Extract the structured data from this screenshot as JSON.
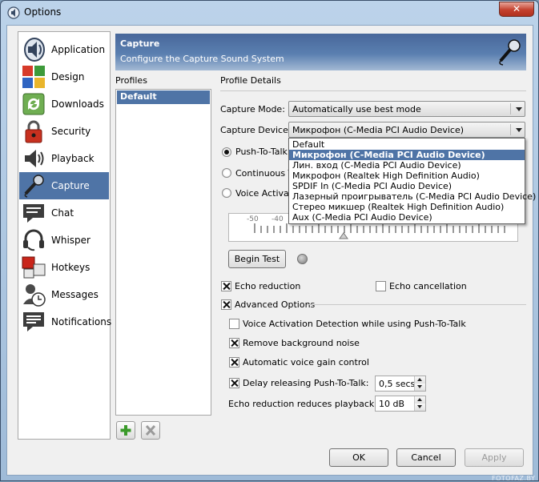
{
  "window": {
    "title": "Options",
    "close_glyph": "✕"
  },
  "nav": {
    "items": [
      {
        "label": "Application",
        "icon": "speaker-logo-icon",
        "selected": false
      },
      {
        "label": "Design",
        "icon": "color-squares-icon",
        "selected": false
      },
      {
        "label": "Downloads",
        "icon": "refresh-arrows-icon",
        "selected": false
      },
      {
        "label": "Security",
        "icon": "padlock-icon",
        "selected": false
      },
      {
        "label": "Playback",
        "icon": "speaker-icon",
        "selected": false
      },
      {
        "label": "Capture",
        "icon": "microphone-icon",
        "selected": true
      },
      {
        "label": "Chat",
        "icon": "chat-bubble-icon",
        "selected": false
      },
      {
        "label": "Whisper",
        "icon": "headset-icon",
        "selected": false
      },
      {
        "label": "Hotkeys",
        "icon": "keyboard-keys-icon",
        "selected": false
      },
      {
        "label": "Messages",
        "icon": "clock-message-icon",
        "selected": false
      },
      {
        "label": "Notifications",
        "icon": "notification-bubble-icon",
        "selected": false
      }
    ]
  },
  "banner": {
    "title": "Capture",
    "subtitle": "Configure the Capture Sound System",
    "icon": "microphone-icon"
  },
  "profiles": {
    "header": "Profiles",
    "items": [
      "Default"
    ],
    "add_icon": "plus-icon",
    "remove_icon": "x-icon"
  },
  "details": {
    "header": "Profile Details",
    "capture_mode_label": "Capture Mode:",
    "capture_mode_value": "Automatically use best mode",
    "capture_device_label": "Capture Device:",
    "capture_device_value": "Микрофон (C-Media PCI Audio Device)",
    "device_options": [
      "Default",
      "Микрофон (C-Media PCI Audio Device)",
      "Лин. вход (C-Media PCI Audio Device)",
      "Микрофон (Realtek High Definition Audio)",
      "SPDIF In (C-Media PCI Audio Device)",
      "Лазерный проигрыватель (C-Media PCI Audio Device)",
      "Стерео микшер (Realtek High Definition Audio)",
      "Aux (C-Media PCI Audio Device)"
    ],
    "device_highlighted_index": 1,
    "radio_push_to_talk": "Push-To-Talk",
    "radio_continuous": "Continuous Tr",
    "radio_voice_activation": "Voice Activatio",
    "slider_ticks": [
      "-50",
      "-40"
    ],
    "begin_test_label": "Begin Test",
    "echo_reduction_label": "Echo reduction",
    "echo_reduction_checked": true,
    "echo_cancellation_label": "Echo cancellation",
    "echo_cancellation_checked": false,
    "advanced_label": "Advanced Options",
    "advanced_checked": true,
    "vad_ptt_label": "Voice Activation Detection while using Push-To-Talk",
    "vad_ptt_checked": false,
    "remove_noise_label": "Remove background noise",
    "remove_noise_checked": true,
    "agc_label": "Automatic voice gain control",
    "agc_checked": true,
    "delay_ptt_label": "Delay releasing Push-To-Talk:",
    "delay_ptt_checked": true,
    "delay_ptt_value": "0,5 secs",
    "echo_playback_label": "Echo reduction reduces playback by:",
    "echo_playback_value": "10 dB"
  },
  "footer": {
    "ok_label": "OK",
    "cancel_label": "Cancel",
    "apply_label": "Apply"
  },
  "watermark": "FOTOFAZ.BY"
}
